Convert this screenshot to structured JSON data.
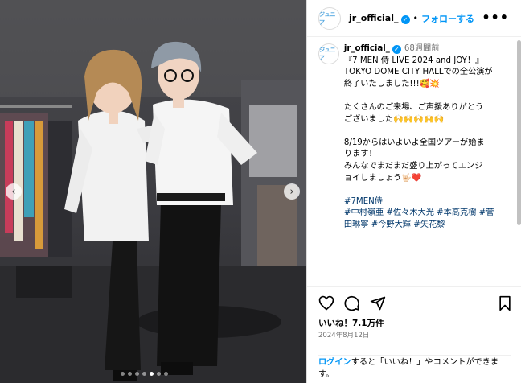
{
  "post": {
    "username": "jr_official_",
    "separator": "•",
    "follow_label": "フォローする",
    "more_label": "•••",
    "avatar_text": "ジュニア",
    "verified_mark": "✓",
    "time_ago": "68週間前"
  },
  "caption": {
    "lines": [
      "『7 MEN 侍 LIVE 2024 and JOY！』",
      "TOKYO DOME CITY HALLでの全公演が",
      "終了いたしました!!!🥰💥",
      "",
      "たくさんのご来場、ご声援ありがとう",
      "ございました🙌🙌🙌🙌🙌",
      "",
      "8/19からはいよいよ全国ツアーが始ま",
      "ります！",
      "みんなでまだまだ盛り上がってエンジ",
      "ョイしましょう🤟🏻❤️",
      ""
    ],
    "hashtag_lines": [
      "#7MEN侍",
      "#中村嶺亜 #佐々木大光 #本髙克樹 #菅",
      "田琳寧 #今野大輝 #矢花黎"
    ]
  },
  "carousel": {
    "prev_label": "‹",
    "next_label": "›",
    "slide_count": 7,
    "active_index": 4
  },
  "actions": {
    "likes": "いいね！7.1万件",
    "date": "2024年8月12日"
  },
  "login": {
    "link": "ログイン",
    "text": "すると「いいね！」やコメントができます。"
  },
  "colors": {
    "accent": "#0095f6",
    "hashtag": "#00376b",
    "muted": "#737373"
  }
}
